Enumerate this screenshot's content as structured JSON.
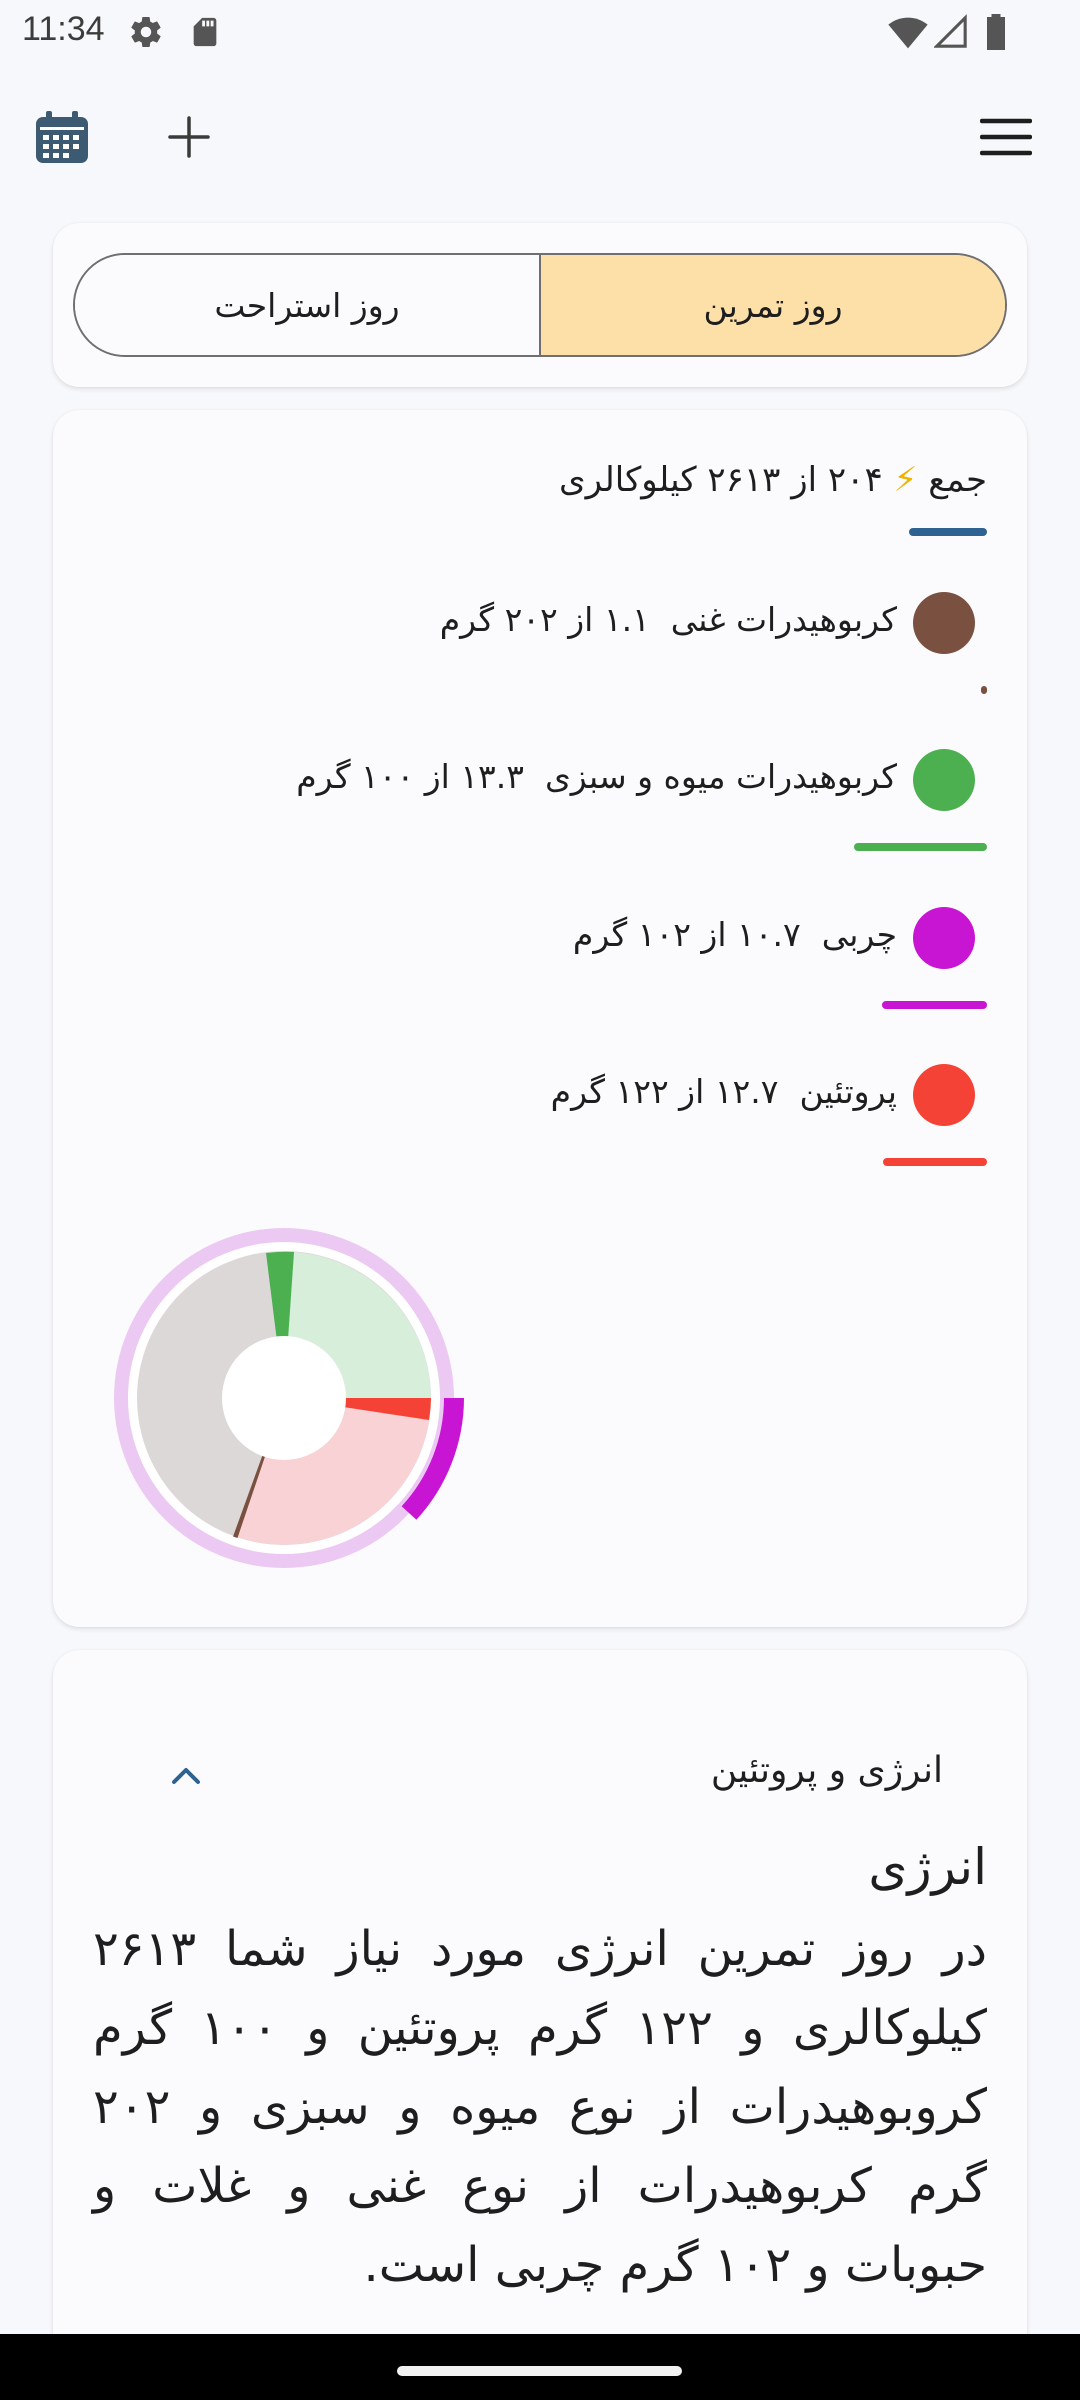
{
  "status_bar": {
    "time": "11:34",
    "icons": [
      "settings-icon",
      "sd-card-icon",
      "wifi-icon",
      "signal-icon",
      "battery-icon"
    ]
  },
  "top_bar": {
    "icons": [
      "calendar-icon",
      "add-icon",
      "menu-icon"
    ]
  },
  "day_toggle": {
    "options": [
      "روز استراحت",
      "روز تمرین"
    ],
    "selected": "روز تمرین",
    "selected_color": "#fde0a8"
  },
  "summary": {
    "total_label": "جمع",
    "total_icon": "⚡",
    "total_text": "۲۰۴  از ۲۶۱۳ کیلوکالری",
    "total_fraction": 0.078,
    "total_color": "#2e6391",
    "macros": [
      {
        "name": "کربوهیدرات غنی",
        "value_text": "۱.۱  از ۲۰۲ گرم",
        "color": "#7a5140",
        "fraction": 0.005
      },
      {
        "name": "کربوهیدرات میوه و سبزی",
        "value_text": "۱۳.۳  از ۱۰۰ گرم",
        "color": "#4caf50",
        "fraction": 0.133
      },
      {
        "name": "چربی",
        "value_text": "۱۰.۷  از ۱۰۲ گرم",
        "color": "#c815d3",
        "fraction": 0.105
      },
      {
        "name": "پروتئین",
        "value_text": "۱۲.۷  از ۱۲۲ گرم",
        "color": "#f44336",
        "fraction": 0.104
      }
    ]
  },
  "energy_section": {
    "header": "انرژی و پروتئین",
    "heading": "انرژی",
    "paragraph": "در روز تمرین انرژی مورد نیاز شما ۲۶۱۳ کیلوکالری و ۱۲۲ گرم پروتئین و ۱۰۰ گرم کروبوهیدرات از نوع میوه و سبزی و ۲۰۲ گرم کربوهیدرات از نوع غنی و غلات و حبوبات و ۱۰۲ گرم چربی است."
  }
}
